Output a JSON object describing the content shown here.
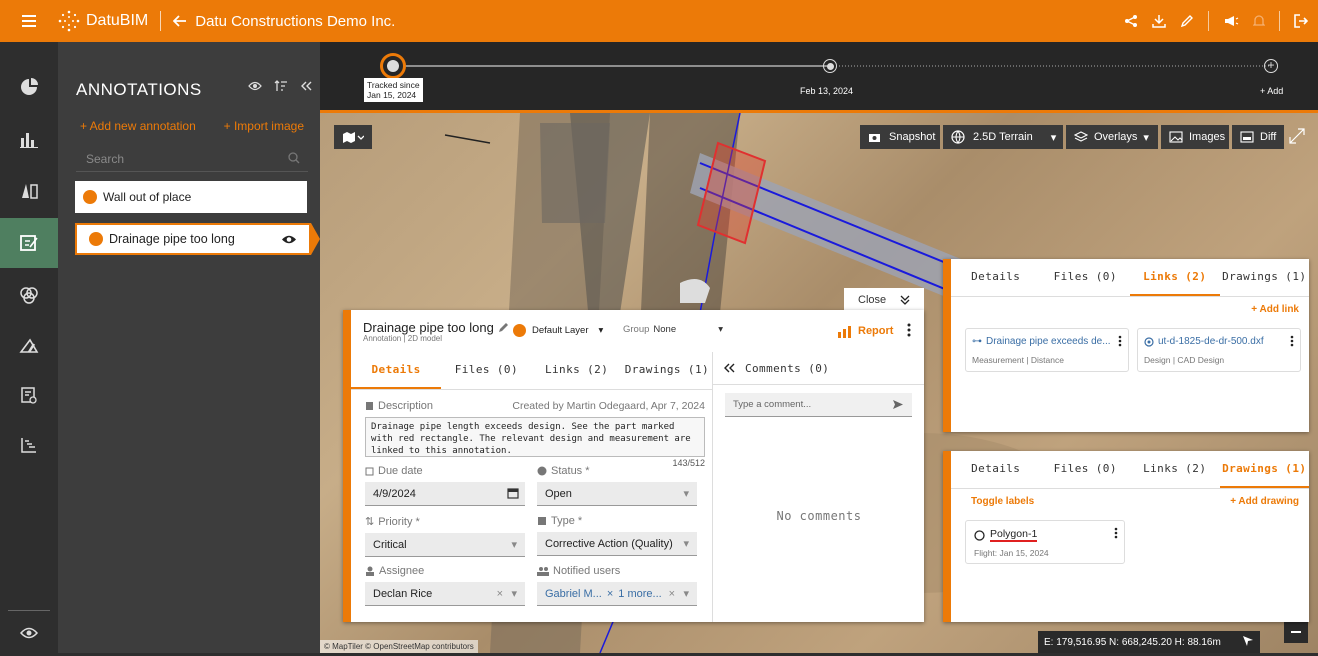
{
  "topbar": {
    "brand": "DatuBIM",
    "project": "Datu Constructions Demo Inc."
  },
  "sidebar": {
    "title": "ANNOTATIONS",
    "add_annotation": "+ Add new annotation",
    "import_image": "+ Import image",
    "search_placeholder": "Search",
    "items": [
      {
        "label": "Wall out of place"
      },
      {
        "label": "Drainage pipe too long"
      }
    ]
  },
  "timeline": {
    "tracked_line1": "Tracked since",
    "tracked_line2": "Jan 15, 2024",
    "date": "Feb 13, 2024",
    "add": "+ Add"
  },
  "map_toolbar": {
    "snapshot": "Snapshot",
    "terrain": "2.5D Terrain",
    "overlays": "Overlays",
    "images": "Images",
    "diff": "Diff"
  },
  "detail": {
    "close": "Close",
    "title": "Drainage pipe too long",
    "subtitle": "Annotation | 2D model",
    "layer": "Default Layer",
    "group_label": "Group",
    "group_value": "None",
    "report": "Report",
    "tabs": [
      "Details",
      "Files (0)",
      "Links (2)",
      "Drawings (1)"
    ],
    "description_label": "Description",
    "created": "Created by Martin Odegaard,  Apr 7, 2024",
    "description": "Drainage pipe length exceeds design. See the part marked with red rectangle. The relevant design and measurement are linked to this annotation.",
    "char_count": "143/512",
    "due_label": "Due date",
    "due_value": "4/9/2024",
    "status_label": "Status *",
    "status_value": "Open",
    "priority_label": "Priority *",
    "priority_value": "Critical",
    "type_label": "Type *",
    "type_value": "Corrective Action (Quality)",
    "assignee_label": "Assignee",
    "assignee_value": "Declan Rice",
    "notified_label": "Notified users",
    "notified_value": "Gabriel M...",
    "notified_more": "1 more..."
  },
  "comments": {
    "title": "Comments (0)",
    "placeholder": "Type a comment...",
    "empty": "No comments"
  },
  "links_panel": {
    "tabs": [
      "Details",
      "Files (0)",
      "Links (2)",
      "Drawings (1)"
    ],
    "add": "+ Add link",
    "cards": [
      {
        "title": "Drainage pipe exceeds de...",
        "meta": "Measurement | Distance"
      },
      {
        "title": "ut-d-1825-de-dr-500.dxf",
        "meta": "Design | CAD Design"
      }
    ]
  },
  "drawings_panel": {
    "tabs": [
      "Details",
      "Files (0)",
      "Links (2)",
      "Drawings (1)"
    ],
    "toggle": "Toggle labels",
    "add": "+ Add drawing",
    "card": {
      "title": "Polygon-1",
      "meta": "Flight: Jan 15, 2024"
    }
  },
  "map": {
    "coords": "E: 179,516.95  N: 668,245.20  H: 88.16m",
    "attribution": "© MapTiler © OpenStreetMap contributors"
  },
  "colors": {
    "accent": "#ec7a08",
    "nav_active": "#4f7f60",
    "panel": "#3d3d3d"
  }
}
